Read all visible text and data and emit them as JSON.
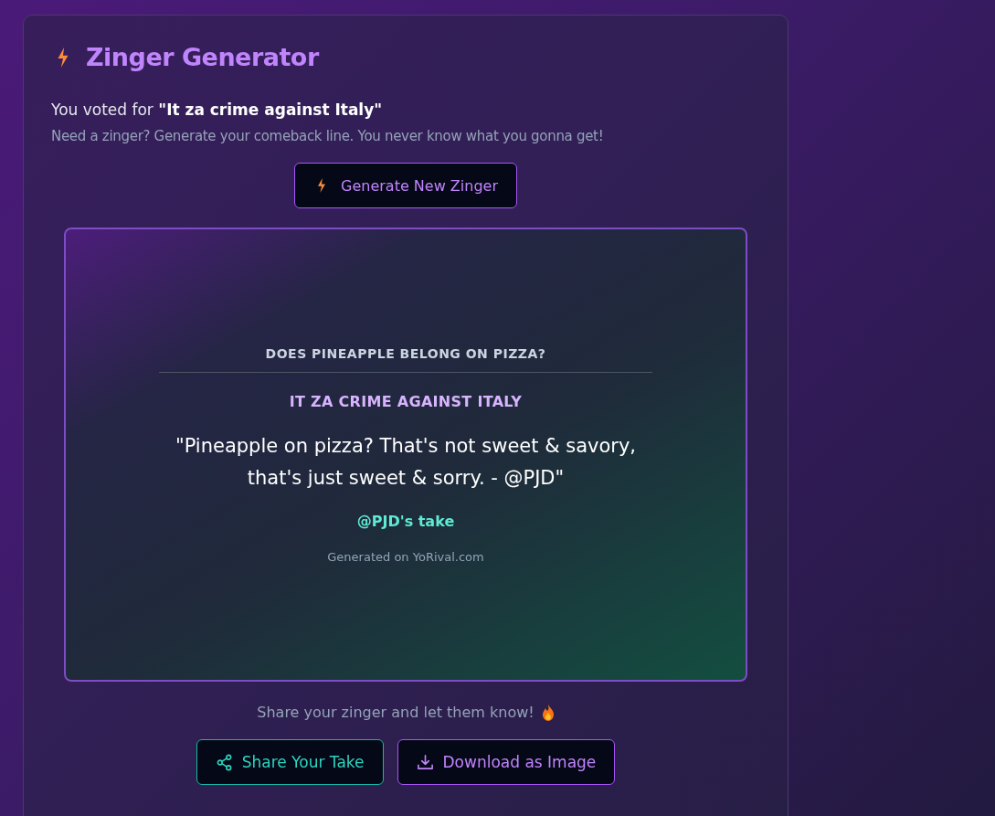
{
  "title": "Zinger Generator",
  "vote": {
    "prefix": "You voted for",
    "choice": "\"It za crime against Italy\""
  },
  "subtitle": "Need a zinger? Generate your comeback line. You never know what you gonna get!",
  "generate_button": "Generate New Zinger",
  "zinger_card": {
    "question": "DOES PINEAPPLE BELONG ON PIZZA?",
    "answer": "IT ZA CRIME AGAINST ITALY",
    "quote": "\"Pineapple on pizza? That's not sweet & savory, that's just sweet & sorry. - @PJD\"",
    "author": "@PJD's take",
    "footer": "Generated on YoRival.com"
  },
  "share_prompt": "Share your zinger and let them know!",
  "actions": [
    {
      "kind": "share",
      "label": "Share Your Take"
    },
    {
      "kind": "download",
      "label": "Download as Image"
    }
  ]
}
